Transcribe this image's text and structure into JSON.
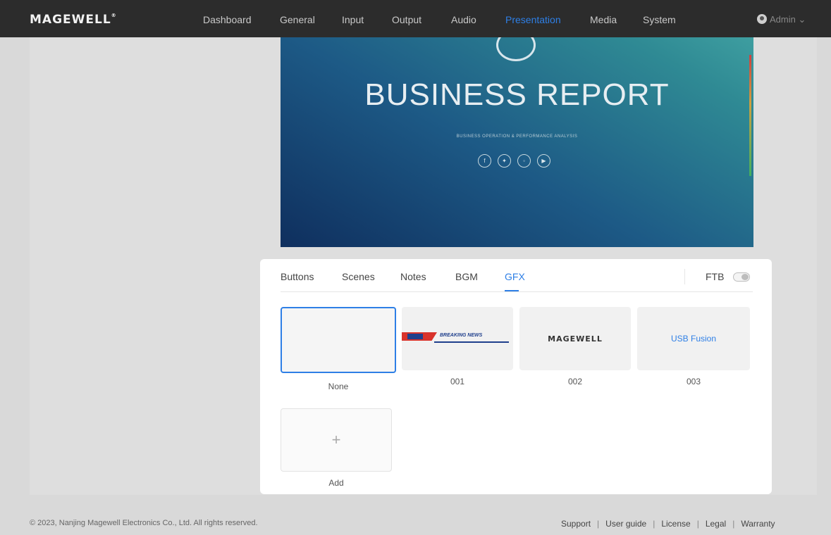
{
  "brand": {
    "logo": "MAGEWELL"
  },
  "nav": {
    "items": [
      {
        "label": "Dashboard"
      },
      {
        "label": "General"
      },
      {
        "label": "Input"
      },
      {
        "label": "Output"
      },
      {
        "label": "Audio"
      },
      {
        "label": "Presentation"
      },
      {
        "label": "Media"
      },
      {
        "label": "System"
      }
    ],
    "active": "Presentation",
    "user": "Admin"
  },
  "preview": {
    "title": "BUSINESS REPORT",
    "subtitle": "BUSINESS OPERATION & PERFORMANCE ANALYSIS",
    "social_icons": [
      "facebook-icon",
      "twitter-icon",
      "instagram-icon",
      "youtube-icon"
    ]
  },
  "panel": {
    "tabs": [
      {
        "label": "Buttons"
      },
      {
        "label": "Scenes"
      },
      {
        "label": "Notes"
      },
      {
        "label": "BGM"
      },
      {
        "label": "GFX"
      }
    ],
    "active_tab": "GFX",
    "ftb": {
      "label": "FTB",
      "state": "off"
    }
  },
  "gfx": {
    "items": [
      {
        "label": "None",
        "selected": true
      },
      {
        "label": "001",
        "thumb_text": "BREAKING NEWS"
      },
      {
        "label": "002",
        "thumb_text": "MAGEWELL"
      },
      {
        "label": "003",
        "thumb_text": "USB Fusion"
      }
    ],
    "add": {
      "label": "Add",
      "symbol": "+"
    }
  },
  "footer": {
    "copyright": "© 2023, Nanjing Magewell Electronics Co., Ltd. All rights reserved.",
    "links": [
      "Support",
      "User guide",
      "License",
      "Legal",
      "Warranty"
    ],
    "separator": "|"
  },
  "colors": {
    "accent": "#2e7fe6",
    "topbar": "#2c2c2c"
  }
}
